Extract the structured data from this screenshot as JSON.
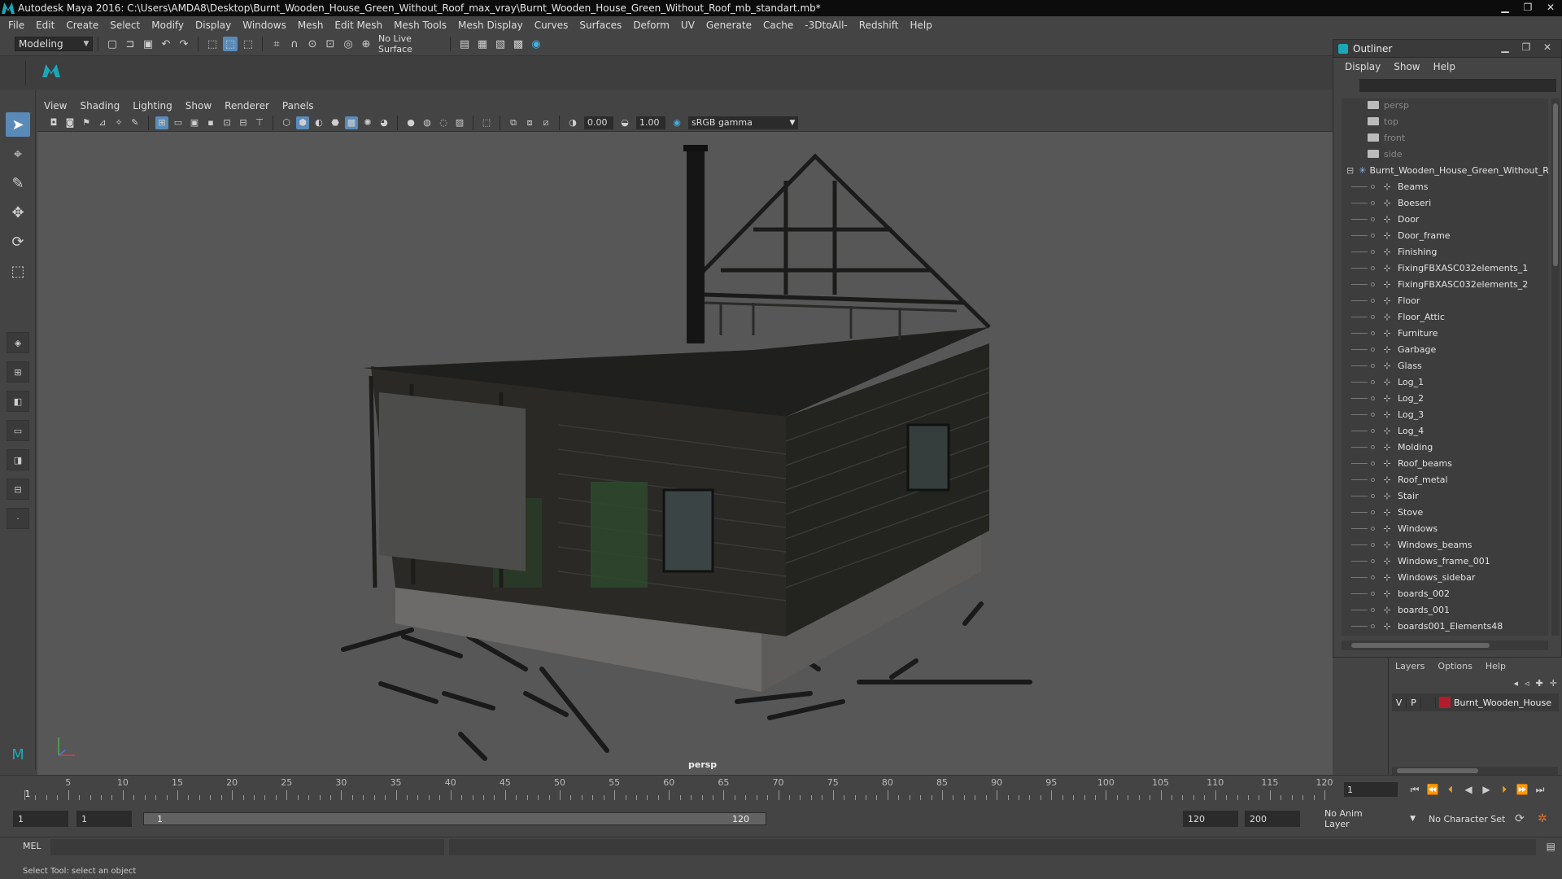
{
  "window": {
    "title": "Autodesk Maya 2016: C:\\Users\\AMDA8\\Desktop\\Burnt_Wooden_House_Green_Without_Roof_max_vray\\Burnt_Wooden_House_Green_Without_Roof_mb_standart.mb*",
    "minimize": "▁",
    "maximize": "❐",
    "close": "✕"
  },
  "menubar": [
    "File",
    "Edit",
    "Create",
    "Select",
    "Modify",
    "Display",
    "Windows",
    "Mesh",
    "Edit Mesh",
    "Mesh Tools",
    "Mesh Display",
    "Curves",
    "Surfaces",
    "Deform",
    "UV",
    "Generate",
    "Cache",
    "-3DtoAll-",
    "Redshift",
    "Help"
  ],
  "statusline": {
    "mode": "Modeling",
    "live_surface": "No Live Surface"
  },
  "panel": {
    "menus": [
      "View",
      "Shading",
      "Lighting",
      "Show",
      "Renderer",
      "Panels"
    ],
    "exposure": "0.00",
    "gamma": "1.00",
    "color_space": "sRGB gamma",
    "camera": "persp"
  },
  "outliner": {
    "title": "Outliner",
    "menus": [
      "Display",
      "Show",
      "Help"
    ],
    "cameras": [
      "persp",
      "top",
      "front",
      "side"
    ],
    "root": "Burnt_Wooden_House_Green_Without_Roof",
    "children": [
      "Beams",
      "Boeseri",
      "Door",
      "Door_frame",
      "Finishing",
      "FixingFBXASC032elements_1",
      "FixingFBXASC032elements_2",
      "Floor",
      "Floor_Attic",
      "Furniture",
      "Garbage",
      "Glass",
      "Log_1",
      "Log_2",
      "Log_3",
      "Log_4",
      "Molding",
      "Roof_beams",
      "Roof_metal",
      "Stair",
      "Stove",
      "Windows",
      "Windows_beams",
      "Windows_frame_001",
      "Windows_sidebar",
      "boards_002",
      "boards_001",
      "boards001_Elements48"
    ]
  },
  "layers": {
    "menus": [
      "Layers",
      "Options",
      "Help"
    ],
    "row": {
      "v": "V",
      "p": "P",
      "name": "Burnt_Wooden_House"
    }
  },
  "timeline": {
    "ticks": [
      1,
      5,
      10,
      15,
      20,
      25,
      30,
      35,
      40,
      45,
      50,
      55,
      60,
      65,
      70,
      75,
      80,
      85,
      90,
      95,
      100,
      105,
      110,
      115,
      120
    ],
    "current_frame": "1"
  },
  "range": {
    "start": "1",
    "playback_start": "1",
    "bar_start": "1",
    "bar_end": "120",
    "playback_end": "120",
    "end": "200",
    "anim_layer": "No Anim Layer",
    "character_set": "No Character Set"
  },
  "cmdline": {
    "label": "MEL"
  },
  "helpline": "Select Tool: select an object"
}
